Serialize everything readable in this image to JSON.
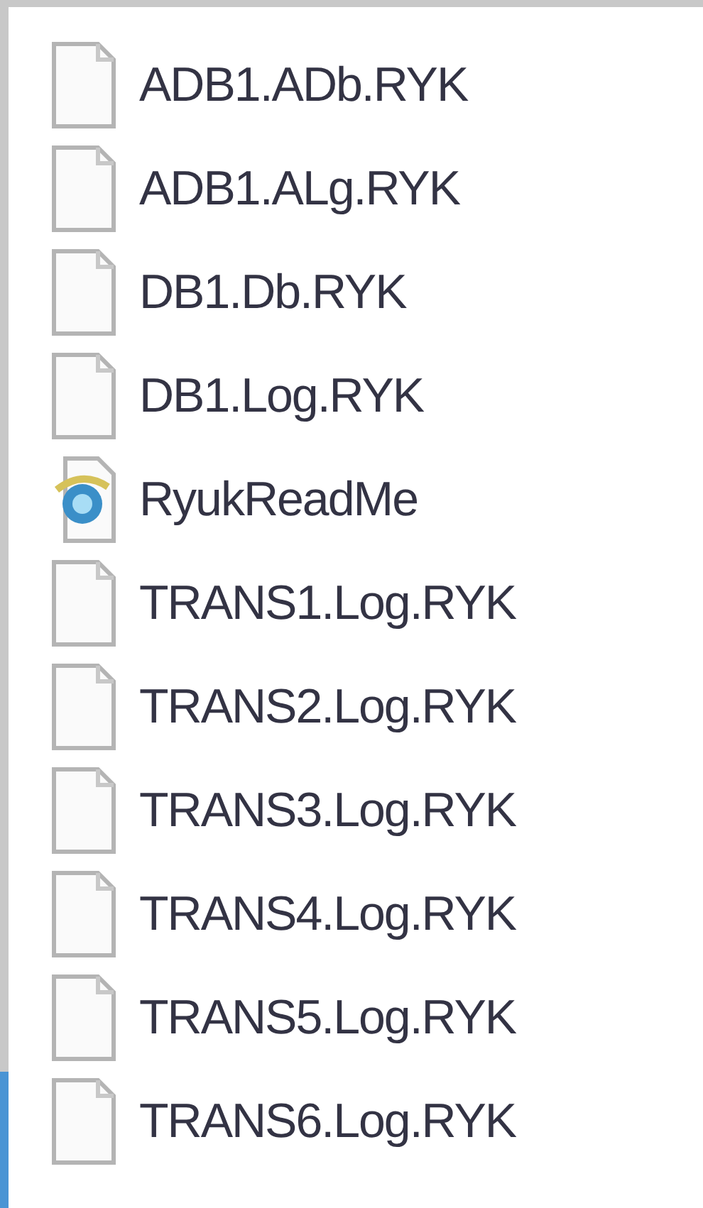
{
  "files": [
    {
      "kind": "file",
      "name": "ADB1.ADb.RYK"
    },
    {
      "kind": "file",
      "name": "ADB1.ALg.RYK"
    },
    {
      "kind": "file",
      "name": "DB1.Db.RYK"
    },
    {
      "kind": "file",
      "name": "DB1.Log.RYK"
    },
    {
      "kind": "web",
      "name": "RyukReadMe"
    },
    {
      "kind": "file",
      "name": "TRANS1.Log.RYK"
    },
    {
      "kind": "file",
      "name": "TRANS2.Log.RYK"
    },
    {
      "kind": "file",
      "name": "TRANS3.Log.RYK"
    },
    {
      "kind": "file",
      "name": "TRANS4.Log.RYK"
    },
    {
      "kind": "file",
      "name": "TRANS5.Log.RYK"
    },
    {
      "kind": "file",
      "name": "TRANS6.Log.RYK"
    }
  ]
}
